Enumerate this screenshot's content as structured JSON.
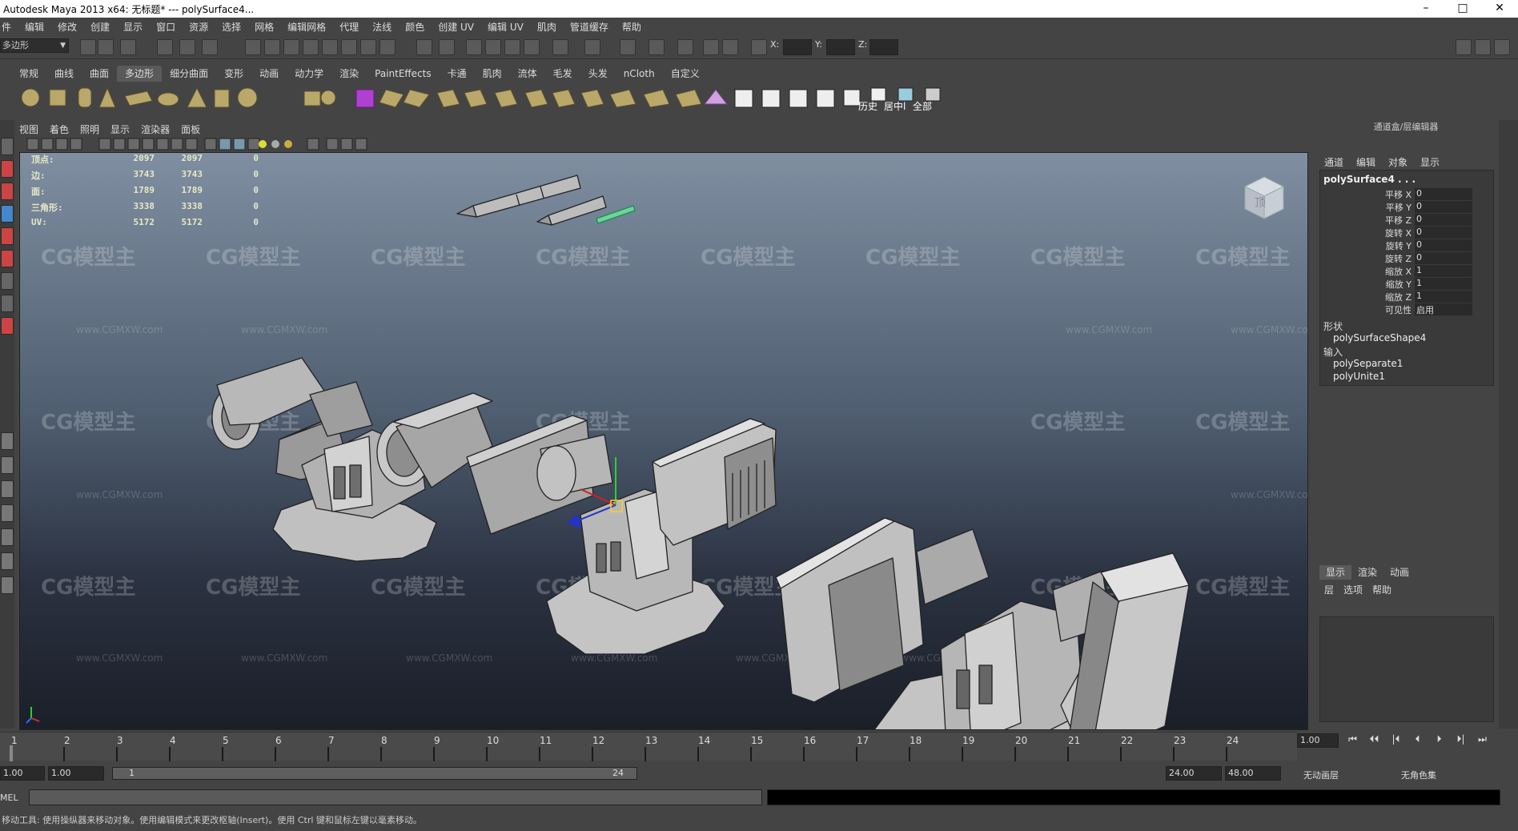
{
  "window": {
    "title": "Autodesk Maya 2013 x64: 无标题*   ---   polySurface4...",
    "minimize": "–",
    "maximize": "□",
    "close": "✕"
  },
  "menubar": [
    "件",
    "编辑",
    "修改",
    "创建",
    "显示",
    "窗口",
    "资源",
    "选择",
    "网格",
    "编辑网格",
    "代理",
    "法线",
    "颜色",
    "创建 UV",
    "编辑 UV",
    "肌肉",
    "管道缓存",
    "帮助"
  ],
  "status": {
    "mode": "多边形",
    "x_label": "X:",
    "y_label": "Y:",
    "z_label": "Z:"
  },
  "shelf_tabs": [
    "常规",
    "曲线",
    "曲面",
    "多边形",
    "细分曲面",
    "变形",
    "动画",
    "动力学",
    "渲染",
    "PaintEffects",
    "卡通",
    "肌肉",
    "流体",
    "毛发",
    "头发",
    "nCloth",
    "自定义"
  ],
  "shelf_active": "多边形",
  "shelf_labels": {
    "history": "历史",
    "center": "居中l",
    "all": "全部"
  },
  "panel_menu": [
    "视图",
    "着色",
    "照明",
    "显示",
    "渲染器",
    "面板"
  ],
  "hud": [
    {
      "label": "顶点:",
      "a": "2097",
      "b": "2097",
      "c": "0"
    },
    {
      "label": "边:",
      "a": "3743",
      "b": "3743",
      "c": "0"
    },
    {
      "label": "面:",
      "a": "1789",
      "b": "1789",
      "c": "0"
    },
    {
      "label": "三角形:",
      "a": "3338",
      "b": "3338",
      "c": "0"
    },
    {
      "label": "UV:",
      "a": "5172",
      "b": "5172",
      "c": "0"
    }
  ],
  "viewcube_label": "顶",
  "watermark": {
    "logo": "CG模型主",
    "url": "www.CGMXW.com"
  },
  "right_panel": {
    "title": "通道盒/层编辑器",
    "menu": [
      "通道",
      "编辑",
      "对象",
      "显示"
    ],
    "object": "polySurface4 . . .",
    "channels": [
      {
        "k": "平移 X",
        "v": "0"
      },
      {
        "k": "平移 Y",
        "v": "0"
      },
      {
        "k": "平移 Z",
        "v": "0"
      },
      {
        "k": "旋转 X",
        "v": "0"
      },
      {
        "k": "旋转 Y",
        "v": "0"
      },
      {
        "k": "旋转 Z",
        "v": "0"
      },
      {
        "k": "缩放 X",
        "v": "1"
      },
      {
        "k": "缩放 Y",
        "v": "1"
      },
      {
        "k": "缩放 Z",
        "v": "1"
      },
      {
        "k": "可见性",
        "v": "启用"
      }
    ],
    "shape_label": "形状",
    "shape": "polySurfaceShape4",
    "input_label": "输入",
    "inputs": [
      "polySeparate1",
      "polyUnite1"
    ],
    "layer_tabs": [
      "显示",
      "渲染",
      "动画"
    ],
    "layer_menu": [
      "层",
      "选项",
      "帮助"
    ]
  },
  "timeline": {
    "numbers": [
      "1",
      "2",
      "3",
      "4",
      "5",
      "6",
      "7",
      "8",
      "9",
      "10",
      "11",
      "12",
      "13",
      "14",
      "15",
      "16",
      "17",
      "18",
      "19",
      "20",
      "21",
      "22",
      "23",
      "24"
    ],
    "current": "1.00"
  },
  "playback": [
    "⏮",
    "⏴⏴",
    "|⏴",
    "⏴",
    "⏵",
    "⏵|",
    "⏭"
  ],
  "range": {
    "start": "1.00",
    "playstart": "1.00",
    "slider_start": "1",
    "slider_end": "24",
    "playend": "24.00",
    "end": "48.00",
    "anim_layer": "无动画层",
    "char_set": "无角色集"
  },
  "mel": {
    "label": "MEL"
  },
  "help": "移动工具: 使用操纵器来移动对象。使用编辑模式来更改枢轴(Insert)。使用 Ctrl 键和鼠标左键以毫素移动。"
}
